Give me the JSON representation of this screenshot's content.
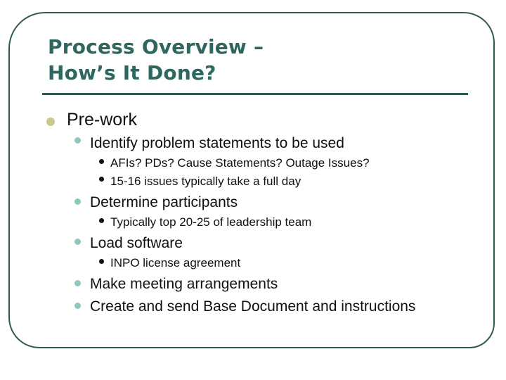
{
  "slide": {
    "title_line1": "Process Overview –",
    "title_line2": "How’s It Done?",
    "colors": {
      "frame": "#2f5a58",
      "title": "#2e6660",
      "bullet_level1": "#c9c98c",
      "bullet_level2": "#8fc6c1",
      "bullet_level3": "#111111",
      "text": "#111111"
    },
    "bullets": {
      "prework": "Pre-work",
      "identify": "Identify problem statements to be used",
      "afis": "AFIs? PDs? Cause Statements? Outage Issues?",
      "issues": "15-16 issues typically take a full day",
      "determine": "Determine participants",
      "typically": "Typically top 20-25 of leadership team",
      "load": "Load software",
      "inpo": "INPO license agreement",
      "meeting": "Make meeting arrangements",
      "create": "Create and send Base Document and instructions"
    }
  }
}
